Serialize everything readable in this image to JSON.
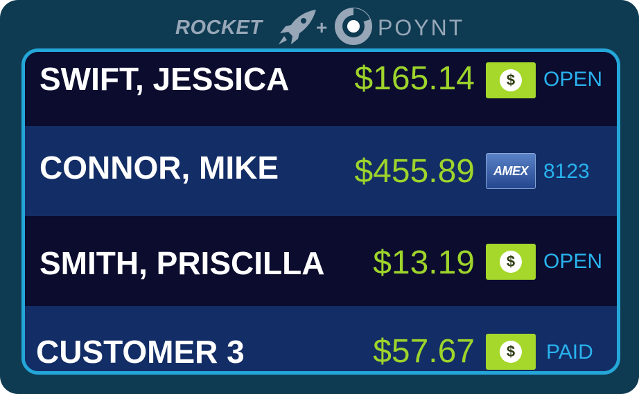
{
  "header": {
    "logo_left": "ROCKET",
    "logo_plus": "+",
    "logo_right": "POYNT"
  },
  "colors": {
    "frame": "#0f3b52",
    "screen_border": "#24a6d9",
    "row_dark": "#0b0c2e",
    "row_light": "#132d66",
    "amount": "#9ed42b",
    "status": "#29b3ee"
  },
  "rows": [
    {
      "name": "SWIFT, JESSICA",
      "amount": "$165.14",
      "payment_icon": "cash-icon",
      "status": "OPEN"
    },
    {
      "name": "CONNOR, MIKE",
      "amount": "$455.89",
      "payment_icon": "amex-card-icon",
      "card_brand": "AMEX",
      "status": "8123"
    },
    {
      "name": "SMITH, PRISCILLA",
      "amount": "$13.19",
      "payment_icon": "cash-icon",
      "status": "OPEN"
    },
    {
      "name": "CUSTOMER 3",
      "amount": "$57.67",
      "payment_icon": "cash-icon",
      "status": "PAID"
    }
  ]
}
